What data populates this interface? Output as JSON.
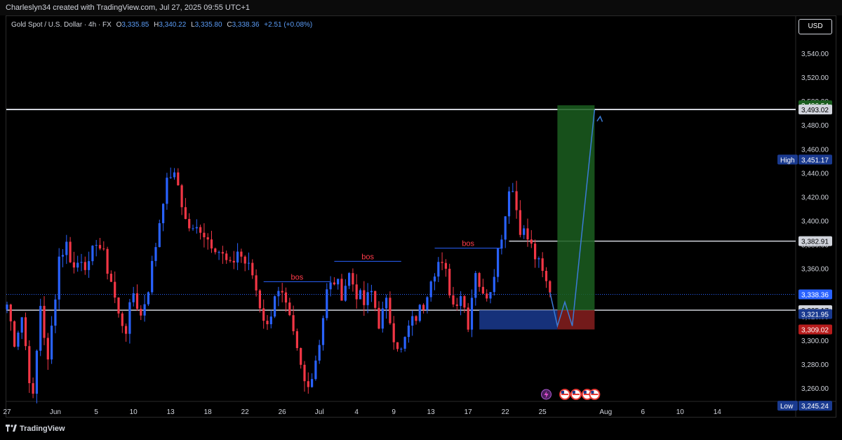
{
  "header": {
    "attribution": "Charleslyn34 created with TradingView.com, Jul 27, 2025 09:55 UTC+1"
  },
  "legend": {
    "symbol": "Gold Spot / U.S. Dollar · 4h · FX",
    "open_label": "O",
    "open": "3,335.85",
    "high_label": "H",
    "high": "3,340.22",
    "low_label": "L",
    "low": "3,335.80",
    "close_label": "C",
    "close": "3,338.36",
    "change": "+2.51 (+0.08%)"
  },
  "currency": "USD",
  "footer": {
    "brand": "TradingView"
  },
  "colors": {
    "up": "#2962ff",
    "down": "#f23645",
    "bos": "#ff3b4a",
    "level_line": "#d1d4dc",
    "tp_zone": "#1b5e20",
    "sl_zone": "#7f1d1d",
    "entry_zone": "#1a3a8f",
    "arrow": "#3b7bd6"
  },
  "chart_data": {
    "type": "candlestick",
    "symbol": "XAUUSD",
    "timeframe": "4h",
    "ylim": [
      3240,
      3560
    ],
    "y_ticks": [
      3260,
      3280,
      3300,
      3320,
      3340,
      3360,
      3380,
      3400,
      3420,
      3440,
      3460,
      3480,
      3500,
      3520,
      3540
    ],
    "y_tick_labels": [
      "3,260.00",
      "3,280.00",
      "3,300.00",
      "3,320.00",
      "3,340.00",
      "3,360.00",
      "3,380.00",
      "3,400.00",
      "3,420.00",
      "3,440.00",
      "3,460.00",
      "3,480.00",
      "3,500.00",
      "3,520.00",
      "3,540.00"
    ],
    "x_ticks": [
      {
        "label": "27",
        "bar": 0
      },
      {
        "label": "Jun",
        "bar": 13
      },
      {
        "label": "5",
        "bar": 24
      },
      {
        "label": "10",
        "bar": 34
      },
      {
        "label": "13",
        "bar": 44
      },
      {
        "label": "18",
        "bar": 54
      },
      {
        "label": "22",
        "bar": 64
      },
      {
        "label": "26",
        "bar": 74
      },
      {
        "label": "Jul",
        "bar": 84
      },
      {
        "label": "4",
        "bar": 94
      },
      {
        "label": "9",
        "bar": 104
      },
      {
        "label": "13",
        "bar": 114
      },
      {
        "label": "17",
        "bar": 124
      },
      {
        "label": "22",
        "bar": 134
      },
      {
        "label": "25",
        "bar": 144
      },
      {
        "label": "Aug",
        "bar": 161
      },
      {
        "label": "6",
        "bar": 171
      },
      {
        "label": "10",
        "bar": 181
      },
      {
        "label": "14",
        "bar": 191
      }
    ],
    "anchors": [
      [
        0,
        3330
      ],
      [
        2,
        3300
      ],
      [
        4,
        3320
      ],
      [
        6,
        3270
      ],
      [
        7,
        3250
      ],
      [
        9,
        3330
      ],
      [
        11,
        3280
      ],
      [
        14,
        3370
      ],
      [
        16,
        3380
      ],
      [
        18,
        3360
      ],
      [
        20,
        3370
      ],
      [
        22,
        3360
      ],
      [
        24,
        3385
      ],
      [
        26,
        3370
      ],
      [
        28,
        3350
      ],
      [
        30,
        3320
      ],
      [
        32,
        3310
      ],
      [
        34,
        3340
      ],
      [
        36,
        3320
      ],
      [
        38,
        3345
      ],
      [
        40,
        3380
      ],
      [
        42,
        3420
      ],
      [
        44,
        3440
      ],
      [
        46,
        3430
      ],
      [
        48,
        3400
      ],
      [
        50,
        3390
      ],
      [
        52,
        3395
      ],
      [
        54,
        3385
      ],
      [
        56,
        3380
      ],
      [
        58,
        3370
      ],
      [
        60,
        3360
      ],
      [
        62,
        3375
      ],
      [
        64,
        3365
      ],
      [
        66,
        3355
      ],
      [
        68,
        3330
      ],
      [
        70,
        3310
      ],
      [
        72,
        3340
      ],
      [
        74,
        3335
      ],
      [
        76,
        3315
      ],
      [
        78,
        3290
      ],
      [
        80,
        3265
      ],
      [
        82,
        3270
      ],
      [
        84,
        3300
      ],
      [
        86,
        3340
      ],
      [
        88,
        3350
      ],
      [
        90,
        3340
      ],
      [
        92,
        3355
      ],
      [
        94,
        3340
      ],
      [
        96,
        3330
      ],
      [
        98,
        3340
      ],
      [
        100,
        3315
      ],
      [
        102,
        3330
      ],
      [
        104,
        3305
      ],
      [
        106,
        3290
      ],
      [
        108,
        3310
      ],
      [
        110,
        3320
      ],
      [
        112,
        3330
      ],
      [
        114,
        3355
      ],
      [
        116,
        3365
      ],
      [
        118,
        3355
      ],
      [
        120,
        3330
      ],
      [
        122,
        3340
      ],
      [
        124,
        3315
      ],
      [
        126,
        3360
      ],
      [
        128,
        3335
      ],
      [
        130,
        3345
      ],
      [
        132,
        3375
      ],
      [
        134,
        3405
      ],
      [
        135,
        3430
      ],
      [
        136,
        3425
      ],
      [
        138,
        3395
      ],
      [
        140,
        3385
      ],
      [
        142,
        3370
      ],
      [
        144,
        3355
      ],
      [
        146,
        3340
      ]
    ],
    "levels": {
      "target_line": 3493.02,
      "resistance": 3382.91,
      "current": 3338.36,
      "support": 3325.17,
      "entry_low": 3309.02
    },
    "price_tags": [
      {
        "label": "3,496.54",
        "value": 3496.54,
        "color": "#1b5e20"
      },
      {
        "label": "3,493.02",
        "value": 3493.02,
        "color": "#d1d4dc"
      },
      {
        "label": "3,451.17",
        "value": 3451.17,
        "color": "#1a3a8f",
        "prefix": "High"
      },
      {
        "label": "3,382.91",
        "value": 3382.91,
        "color": "#d1d4dc"
      },
      {
        "label": "3,338.36",
        "value": 3338.36,
        "color": "#2962ff"
      },
      {
        "label": "3,325.17",
        "value": 3325.17,
        "color": "#d1d4dc"
      },
      {
        "label": "3,321.95",
        "value": 3321.95,
        "color": "#1a3a8f"
      },
      {
        "label": "3,309.02",
        "value": 3309.02,
        "color": "#b71c1c"
      },
      {
        "label": "3,245.24",
        "value": 3245.24,
        "color": "#1a3a8f",
        "prefix": "Low"
      }
    ],
    "annotations": [
      {
        "text": "bos",
        "bar": 78,
        "level": 3349
      },
      {
        "text": "bos",
        "bar": 97,
        "level": 3366
      },
      {
        "text": "bos",
        "bar": 124,
        "level": 3377
      }
    ],
    "position": {
      "entry_bar_start": 148,
      "entry_bar_end": 158,
      "target": 3496.54,
      "entry": 3325.17,
      "stop": 3309.02
    },
    "projection": [
      [
        146,
        3340
      ],
      [
        148,
        3312
      ],
      [
        150,
        3332
      ],
      [
        152,
        3312
      ],
      [
        158,
        3493
      ]
    ]
  }
}
